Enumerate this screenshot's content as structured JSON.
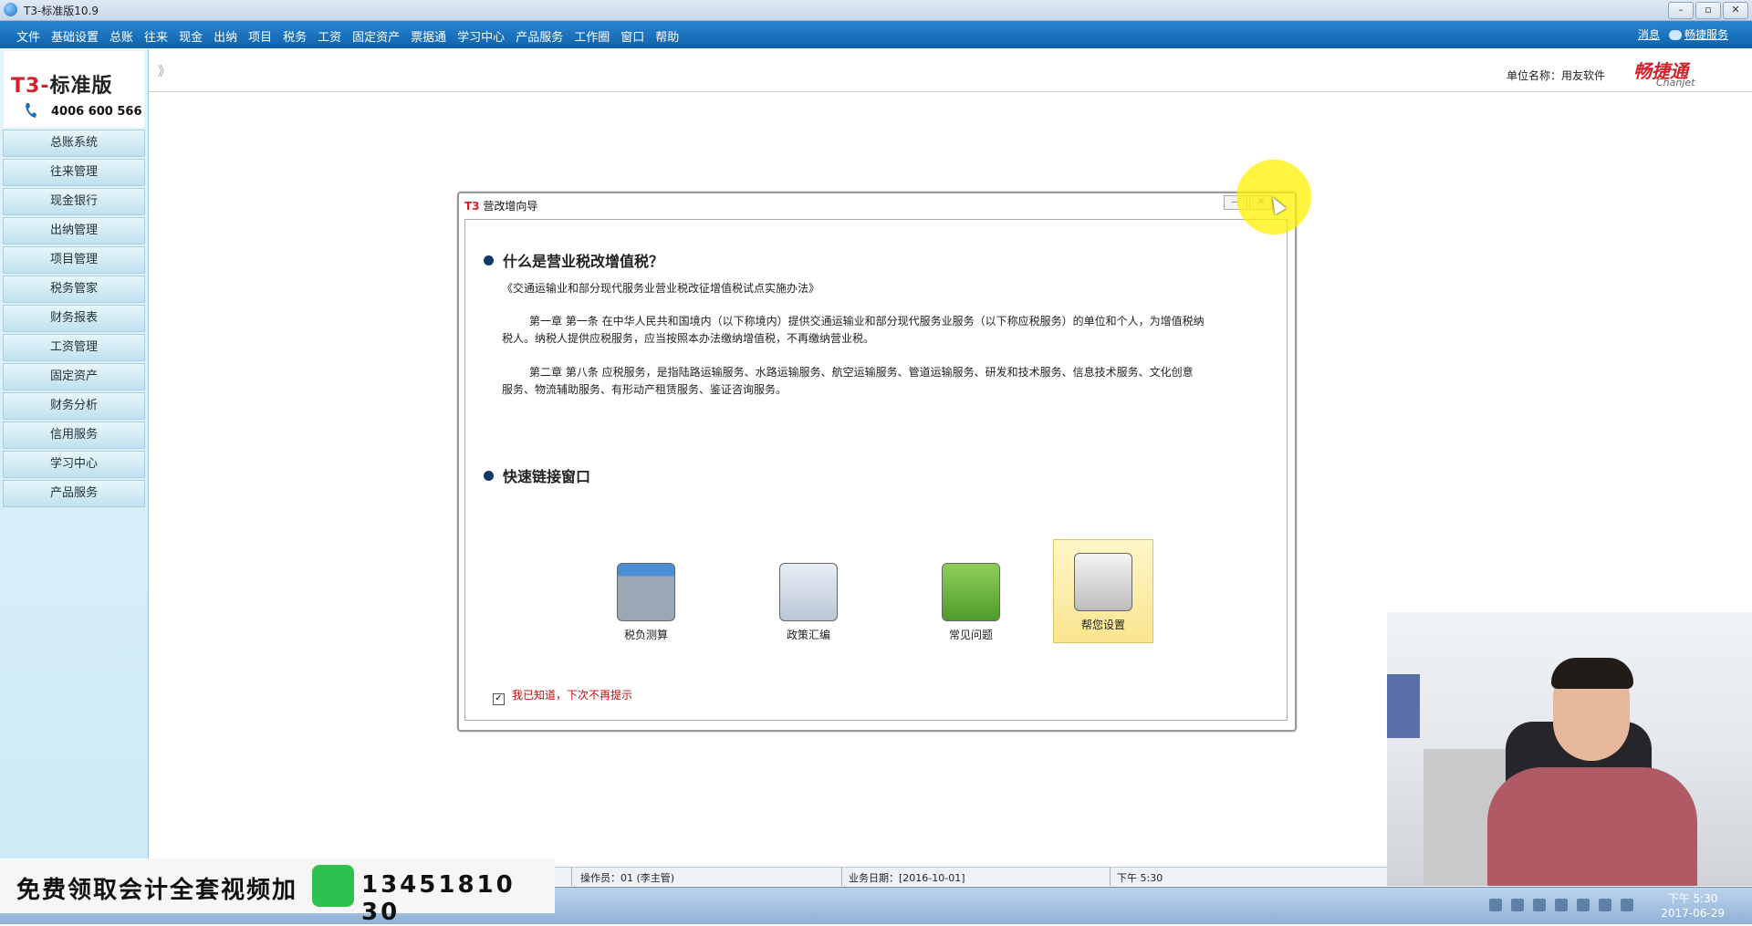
{
  "window": {
    "title": "T3-标准版10.9",
    "min": "–",
    "max": "▫",
    "close": "✕"
  },
  "menubar": {
    "items": [
      "文件",
      "基础设置",
      "总账",
      "往来",
      "现金",
      "出纳",
      "项目",
      "税务",
      "工资",
      "固定资产",
      "票据通",
      "学习中心",
      "产品服务",
      "工作圈",
      "窗口",
      "帮助"
    ],
    "right": {
      "messages": "消息",
      "service": "畅捷服务"
    }
  },
  "sidebar": {
    "logo": {
      "t3": "T3",
      "dash": "-",
      "name": "标准版",
      "phone": "4006 600 566"
    },
    "nav": [
      "总账系统",
      "往来管理",
      "现金银行",
      "出纳管理",
      "项目管理",
      "税务管家",
      "财务报表",
      "工资管理",
      "固定资产",
      "财务分析",
      "信用服务",
      "学习中心",
      "产品服务"
    ]
  },
  "header": {
    "collapse": "》",
    "unit": "单位名称：用友软件",
    "brand": "畅捷通",
    "brand_sub": "Chanjet"
  },
  "dialog": {
    "t3": "T3",
    "title": "营改增向导",
    "min": "—",
    "close": "✕",
    "section1": "什么是营业税改增值税？",
    "doc_title": "《交通运输业和部分现代服务业营业税改征增值税试点实施办法》",
    "para1_line1": "第一章 第一条 在中华人民共和国境内（以下称境内）提供交通运输业和部分现代服务业服务（以下称应税服务）的单位和个人，为增值税纳",
    "para1_line2": "税人。纳税人提供应税服务，应当按照本办法缴纳增值税，不再缴纳营业税。",
    "para2_line1": "第二章 第八条 应税服务，是指陆路运输服务、水路运输服务、航空运输服务、管道运输服务、研发和技术服务、信息技术服务、文化创意",
    "para2_line2": "服务、物流辅助服务、有形动产租赁服务、鉴证咨询服务。",
    "section2": "快速链接窗口",
    "tiles": [
      {
        "label": "税负测算",
        "icon": "calculator-icon"
      },
      {
        "label": "政策汇编",
        "icon": "people-icon"
      },
      {
        "label": "常见问题",
        "icon": "notebook-icon"
      },
      {
        "label": "帮您设置",
        "icon": "settings-icon"
      }
    ],
    "checkbox_mark": "✓",
    "checkbox_label": "我已知道，下次不再提示"
  },
  "statusbar": {
    "operator": "操作员：01 (李主管)",
    "date": "业务日期：[2016-10-01]",
    "time": "下午 5:30"
  },
  "promo": {
    "text": "免费领取会计全套视频加",
    "number": "13451810 30"
  },
  "taskbar": {
    "clock_time": "下午 5:30",
    "clock_date": "2017-06-29"
  },
  "colors": {
    "menubar": "#1a6fbd",
    "accent_red": "#d4202a",
    "sidebar": "#d6eef7",
    "highlight": "#ffee00"
  }
}
